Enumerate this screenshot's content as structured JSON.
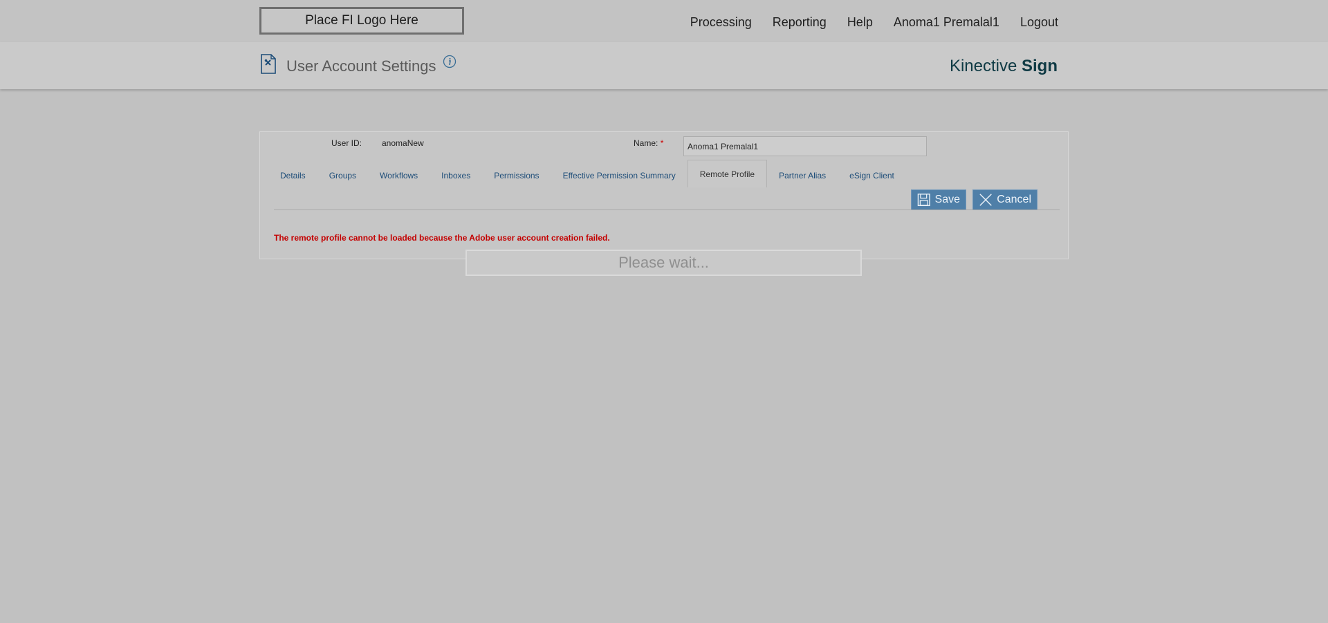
{
  "header": {
    "logo_text": "Place FI Logo Here",
    "nav": [
      "Processing",
      "Reporting",
      "Help",
      "Anoma1 Premalal1",
      "Logout"
    ]
  },
  "title_band": {
    "title": "User Account Settings",
    "brand_light": "Kinective ",
    "brand_bold": "Sign"
  },
  "form": {
    "user_id_label": "User ID:",
    "user_id_value": "anomaNew",
    "name_label": "Name:",
    "name_required": "*",
    "name_value": "Anoma1 Premalal1"
  },
  "tabs": [
    {
      "label": "Details",
      "active": false
    },
    {
      "label": "Groups",
      "active": false
    },
    {
      "label": "Workflows",
      "active": false
    },
    {
      "label": "Inboxes",
      "active": false
    },
    {
      "label": "Permissions",
      "active": false
    },
    {
      "label": "Effective Permission Summary",
      "active": false
    },
    {
      "label": "Remote Profile",
      "active": true
    },
    {
      "label": "Partner Alias",
      "active": false
    },
    {
      "label": "eSign Client",
      "active": false
    }
  ],
  "actions": {
    "save_label": "Save",
    "cancel_label": "Cancel"
  },
  "error_message": "The remote profile cannot be loaded because the Adobe user account creation failed.",
  "overlay": {
    "wait_text": "Please wait..."
  },
  "colors": {
    "button_bg": "#4f7fa8",
    "tab_link": "#1c4c78",
    "error": "#c40000",
    "brand": "#0f3a44"
  }
}
